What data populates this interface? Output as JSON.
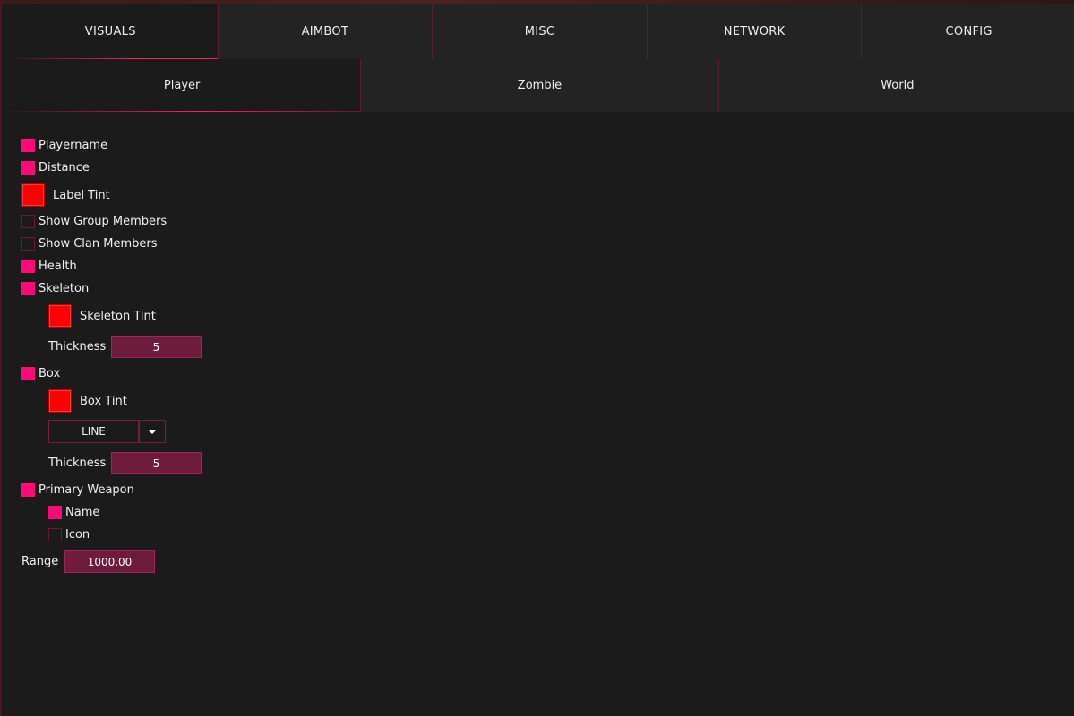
{
  "main_tabs": [
    {
      "label": "VISUALS",
      "active": true
    },
    {
      "label": "AIMBOT",
      "active": false
    },
    {
      "label": "MISC",
      "active": false
    },
    {
      "label": "NETWORK",
      "active": false
    },
    {
      "label": "CONFIG",
      "active": false
    }
  ],
  "sub_tabs": [
    {
      "label": "Player",
      "active": true
    },
    {
      "label": "Zombie",
      "active": false
    },
    {
      "label": "World",
      "active": false
    }
  ],
  "options": {
    "playername": {
      "label": "Playername",
      "checked": true
    },
    "distance": {
      "label": "Distance",
      "checked": true
    },
    "label_tint": {
      "label": "Label Tint",
      "color": "#ff0000"
    },
    "show_group_members": {
      "label": "Show Group Members",
      "checked": false
    },
    "show_clan_members": {
      "label": "Show Clan Members",
      "checked": false
    },
    "health": {
      "label": "Health",
      "checked": true
    },
    "skeleton": {
      "label": "Skeleton",
      "checked": true
    },
    "skeleton_tint": {
      "label": "Skeleton Tint",
      "color": "#ff0000"
    },
    "skeleton_thickness": {
      "label": "Thickness",
      "value": "5"
    },
    "box": {
      "label": "Box",
      "checked": true
    },
    "box_tint": {
      "label": "Box Tint",
      "color": "#ff0000"
    },
    "box_style": {
      "selected": "LINE"
    },
    "box_thickness": {
      "label": "Thickness",
      "value": "5"
    },
    "primary_weapon": {
      "label": "Primary Weapon",
      "checked": true
    },
    "weapon_name": {
      "label": "Name",
      "checked": true
    },
    "weapon_icon": {
      "label": "Icon",
      "checked": false
    },
    "range": {
      "label": "Range",
      "value": "1000.00"
    }
  },
  "colors": {
    "accent": "#ff0a78",
    "background": "#1b1b1b",
    "tab_background": "#232323",
    "input_background": "#6e1b3c",
    "tint": "#ff0000"
  }
}
